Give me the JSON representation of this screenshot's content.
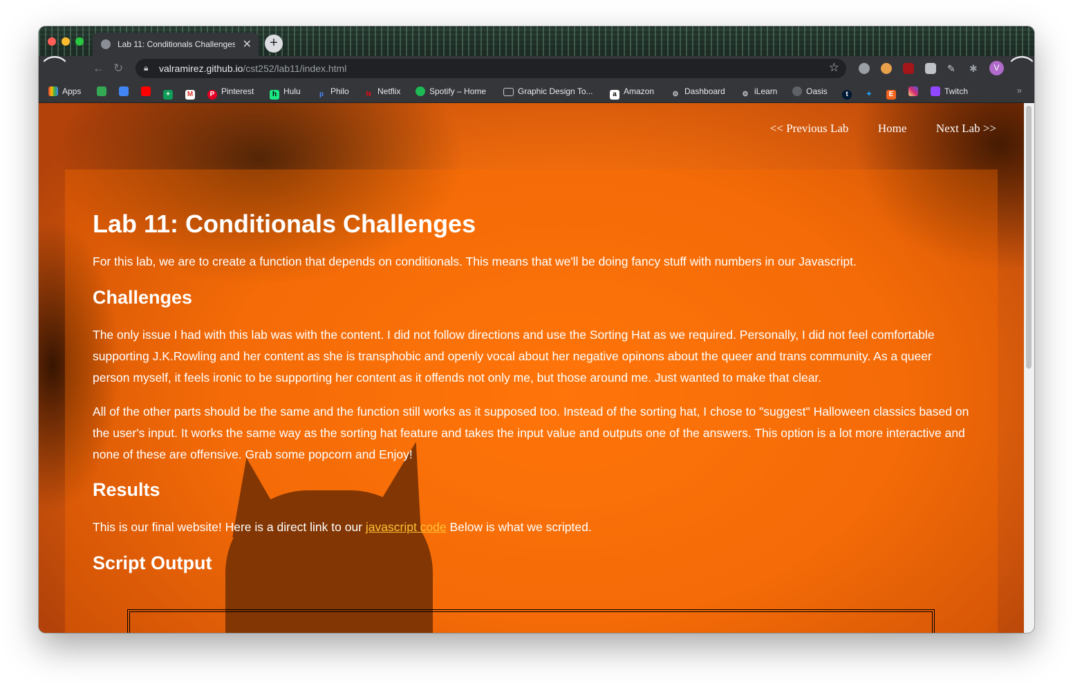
{
  "browser": {
    "tab_title": "Lab 11: Conditionals Challenges",
    "url_host": "valramirez.github.io",
    "url_path": "/cst252/lab11/index.html",
    "profile_initial": "V",
    "bookmarks": [
      {
        "label": "Apps",
        "icon": "apps-grid-icon"
      },
      {
        "label": "",
        "icon": "google-drive-icon"
      },
      {
        "label": "",
        "icon": "google-docs-icon"
      },
      {
        "label": "",
        "icon": "youtube-icon"
      },
      {
        "label": "",
        "icon": "green-cross-icon"
      },
      {
        "label": "",
        "icon": "gmail-icon"
      },
      {
        "label": "Pinterest",
        "icon": "pinterest-icon"
      },
      {
        "label": "Hulu",
        "icon": "hulu-icon"
      },
      {
        "label": "Philo",
        "icon": "philo-icon"
      },
      {
        "label": "Netflix",
        "icon": "netflix-icon"
      },
      {
        "label": "Spotify – Home",
        "icon": "spotify-icon"
      },
      {
        "label": "Graphic Design To...",
        "icon": "folder-icon"
      },
      {
        "label": "Amazon",
        "icon": "amazon-icon"
      },
      {
        "label": "Dashboard",
        "icon": "dashboard-icon"
      },
      {
        "label": "iLearn",
        "icon": "ilearn-icon"
      },
      {
        "label": "Oasis",
        "icon": "globe-icon"
      },
      {
        "label": "",
        "icon": "tumblr-icon"
      },
      {
        "label": "",
        "icon": "twitter-icon"
      },
      {
        "label": "",
        "icon": "etsy-icon"
      },
      {
        "label": "",
        "icon": "instagram-icon"
      },
      {
        "label": "Twitch",
        "icon": "twitch-icon"
      }
    ]
  },
  "page": {
    "nav": {
      "previous": "<< Previous Lab",
      "home": "Home",
      "next": "Next Lab >>"
    },
    "title": "Lab 11: Conditionals Challenges",
    "intro": "For this lab, we are to create a function that depends on conditionals. This means that we'll be doing fancy stuff with numbers in our Javascript.",
    "challenges_heading": "Challenges",
    "challenges_p1": "The only issue I had with this lab was with the content. I did not follow directions and use the Sorting Hat as we required. Personally, I did not feel comfortable supporting J.K.Rowling and her content as she is transphobic and openly vocal about her negative opinons about the queer and trans community. As a queer person myself, it feels ironic to be supporting her content as it offends not only me, but those around me. Just wanted to make that clear.",
    "challenges_p2": "All of the other parts should be the same and the function still works as it supposed too. Instead of the sorting hat, I chose to \"suggest\" Halloween classics based on the user's input. It works the same way as the sorting hat feature and takes the input value and outputs one of the answers. This option is a lot more interactive and none of these are offensive. Grab some popcorn and Enjoy!",
    "results_heading": "Results",
    "results_before": "This is our final website! Here is a direct link to our ",
    "results_link": "javascript code",
    "results_after": " Below is what we scripted.",
    "script_heading": "Script Output"
  }
}
